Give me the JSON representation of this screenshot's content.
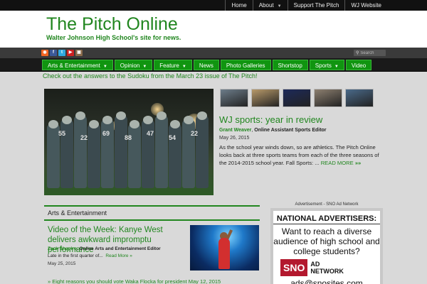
{
  "topnav": {
    "items": [
      {
        "label": "Home"
      },
      {
        "label": "About",
        "dropdown": true
      },
      {
        "label": "Support The Pitch"
      },
      {
        "label": "WJ Website"
      }
    ]
  },
  "header": {
    "title": "The Pitch Online",
    "subtitle": "Walter Johnson High School's site for news."
  },
  "social": {
    "icons": [
      {
        "name": "rss-icon",
        "color": "#f26522",
        "glyph": "◉"
      },
      {
        "name": "facebook-icon",
        "color": "#3b5998",
        "glyph": "f"
      },
      {
        "name": "twitter-icon",
        "color": "#2fa9e0",
        "glyph": "t"
      },
      {
        "name": "youtube-icon",
        "color": "#cc2222",
        "glyph": "▶"
      },
      {
        "name": "instagram-icon",
        "color": "#8a6a4a",
        "glyph": "▣"
      }
    ],
    "search_placeholder": "Search"
  },
  "mainnav": {
    "items": [
      {
        "label": "Arts & Entertainment",
        "dropdown": true
      },
      {
        "label": "Opinion",
        "dropdown": true
      },
      {
        "label": "Feature",
        "dropdown": true
      },
      {
        "label": "News",
        "dropdown": false
      },
      {
        "label": "Photo Galleries",
        "dropdown": false
      },
      {
        "label": "Shortstop",
        "dropdown": false
      },
      {
        "label": "Sports",
        "dropdown": true
      },
      {
        "label": "Video",
        "dropdown": false
      }
    ]
  },
  "announcement": "Check out the answers to the Sudoku from the March 23 issue of The Pitch!",
  "featured": {
    "title": "WJ sports: year in review",
    "author": "Grant Weaver",
    "author_role": "Online Assistant Sports Editor",
    "date": "May 26, 2015",
    "excerpt": "As the school year winds down, so are athletics.  The Pitch Online looks back at three sports teams from each of the three seasons of the 2014-2015 school year. Fall Sports:  ...",
    "read_more": "READ MORE",
    "jersey_numbers": [
      "55",
      "22",
      "69",
      "88",
      "47",
      "54",
      "22"
    ],
    "thumb_colors": [
      "#6d7d8a",
      "#b89a6a",
      "#1d2a5a",
      "#8d8070",
      "#4a6a8a"
    ]
  },
  "section": {
    "title": "Arts & Entertainment",
    "article": {
      "title": "Video of the Week: Kanye West delivers awkward impromptu performance",
      "author": "Zack Shapiro",
      "author_role": "Online Arts and Entertainment Editor",
      "excerpt": "Late in the first quarter of...",
      "read_more": "Read More »",
      "date": "May 25, 2015"
    },
    "next_item": "» Eight reasons you should vote Waka Flocka for president",
    "next_date": "May 12, 2015"
  },
  "ad": {
    "label": "Advertisement - SNO Ad Network",
    "headline": "NATIONAL ADVERTISERS:",
    "body": "Want to reach a diverse audience of high school and college students?",
    "logo_text": "SNO",
    "logo_sub": "AD NETWORK",
    "email": "ads@snosites.com"
  }
}
